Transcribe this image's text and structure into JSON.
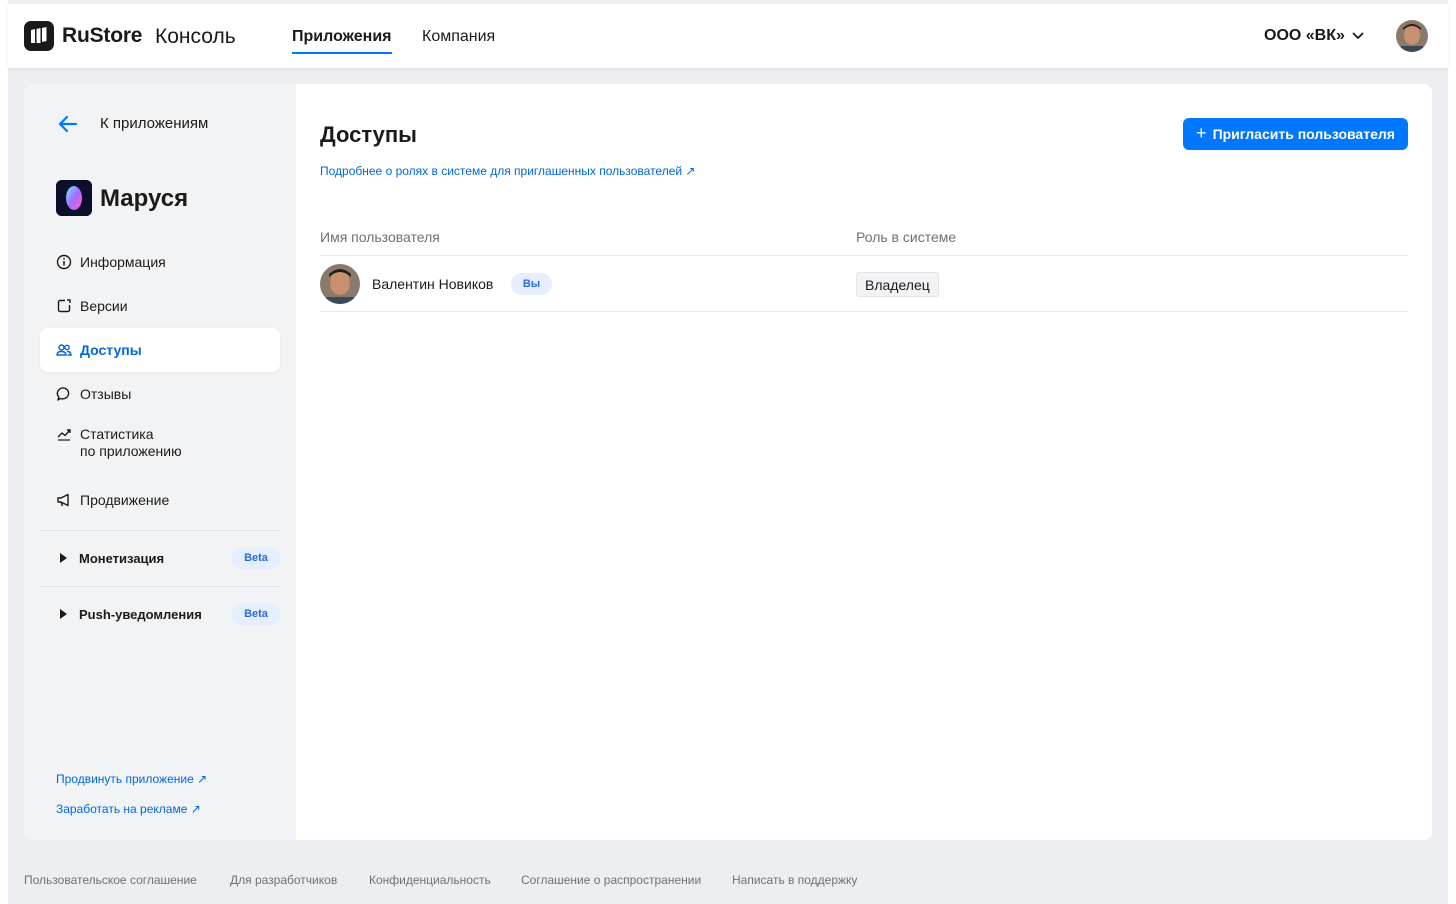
{
  "header": {
    "brand": "RuStore",
    "brand_sub": "Консоль",
    "tabs": [
      {
        "label": "Приложения",
        "active": true
      },
      {
        "label": "Компания",
        "active": false
      }
    ],
    "organization": "ООО «ВК»",
    "avatar_icon": "user-avatar"
  },
  "sidebar": {
    "back_label": "К приложениям",
    "app_name": "Маруся",
    "items": [
      {
        "label": "Информация",
        "icon": "info-icon"
      },
      {
        "label": "Версии",
        "icon": "versions-icon"
      },
      {
        "label": "Доступы",
        "icon": "users-icon",
        "active": true
      },
      {
        "label": "Отзывы",
        "icon": "comment-icon"
      },
      {
        "label": "Статистика",
        "label2": "по приложению",
        "icon": "chart-icon"
      },
      {
        "label": "Продвижение",
        "icon": "megaphone-icon"
      }
    ],
    "groups": [
      {
        "label": "Монетизация",
        "badge": "Beta"
      },
      {
        "label": "Push-уведомления",
        "badge": "Beta"
      }
    ],
    "links": [
      {
        "label": "Продвинуть приложение ↗"
      },
      {
        "label": "Заработать на рекламе ↗"
      }
    ]
  },
  "main": {
    "title": "Доступы",
    "roles_link": "Подробнее о ролях в системе для приглашенных пользователей ↗",
    "invite_button": "Пригласить пользователя",
    "table": {
      "columns": [
        "Имя пользователя",
        "Роль в системе"
      ],
      "rows": [
        {
          "name": "Валентин Новиков",
          "badge": "Вы",
          "role": "Владелец"
        }
      ]
    }
  },
  "footer": {
    "links": [
      "Пользовательское соглашение",
      "Для разработчиков",
      "Конфиденциальность",
      "Соглашение о распространении",
      "Написать в поддержку"
    ]
  },
  "colors": {
    "accent": "#0077ff",
    "link": "#0066dd",
    "sidebar_bg": "#f2f3f5",
    "page_bg": "#eceef2"
  }
}
